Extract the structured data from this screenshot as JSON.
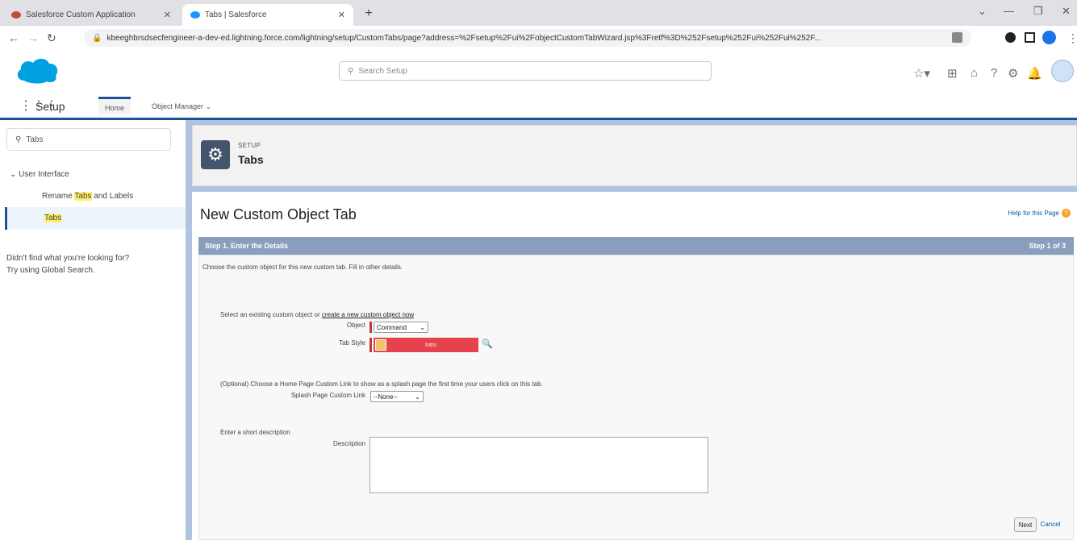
{
  "browser": {
    "tabs": [
      {
        "title": "Salesforce Custom Application",
        "favicon_color": "#c44b39"
      },
      {
        "title": "Tabs | Salesforce",
        "favicon_color": "#1b96ff"
      }
    ],
    "new_tab_label": "+",
    "url": "kbeeghbrsdsecfengineer-a-dev-ed.lightning.force.com/lightning/setup/CustomTabs/page?address=%2Fsetup%2Fui%2FobjectCustomTabWizard.jsp%3Fretf%3D%252Fsetup%252Fui%252Fui%252F..."
  },
  "header": {
    "search_placeholder": "Search Setup"
  },
  "context_nav": {
    "app_name": "Setup",
    "home_tab": "Home",
    "object_manager_tab": "Object Manager"
  },
  "sidebar": {
    "quick_find_value": "Tabs",
    "group_label": "User Interface",
    "rename_prefix": "Rename ",
    "rename_highlight": "Tabs",
    "rename_suffix": " and Labels",
    "tabs_item": "Tabs",
    "not_found_line1": "Didn't find what you're looking for?",
    "not_found_line2": "Try using Global Search."
  },
  "page_header": {
    "eyebrow": "SETUP",
    "title": "Tabs"
  },
  "content": {
    "title": "New Custom Object Tab",
    "help_link": "Help for this Page",
    "step_title": "Step 1. Enter the Details",
    "step_count": "Step 1 of 3",
    "intro": "Choose the custom object for this new custom tab. Fill in other details.",
    "select_text": "Select an existing custom object or ",
    "create_link": "create a new custom object now",
    "object_label": "Object",
    "object_value": "Command",
    "tab_style_label": "Tab Style",
    "tab_style_value": "Intro",
    "splash_text": "(Optional) Choose a Home Page Custom Link to show as a splash page the first time your users click on this tab.",
    "splash_label": "Splash Page Custom Link",
    "splash_value": "--None--",
    "desc_text": "Enter a short description",
    "desc_label": "Description",
    "next_button": "Next",
    "cancel_button": "Cancel"
  },
  "colors": {
    "brand_blue": "#1b5297",
    "step_bar": "#8a9ebe",
    "tab_style": "#e5424d",
    "salesforce_cloud": "#00a1e0"
  }
}
